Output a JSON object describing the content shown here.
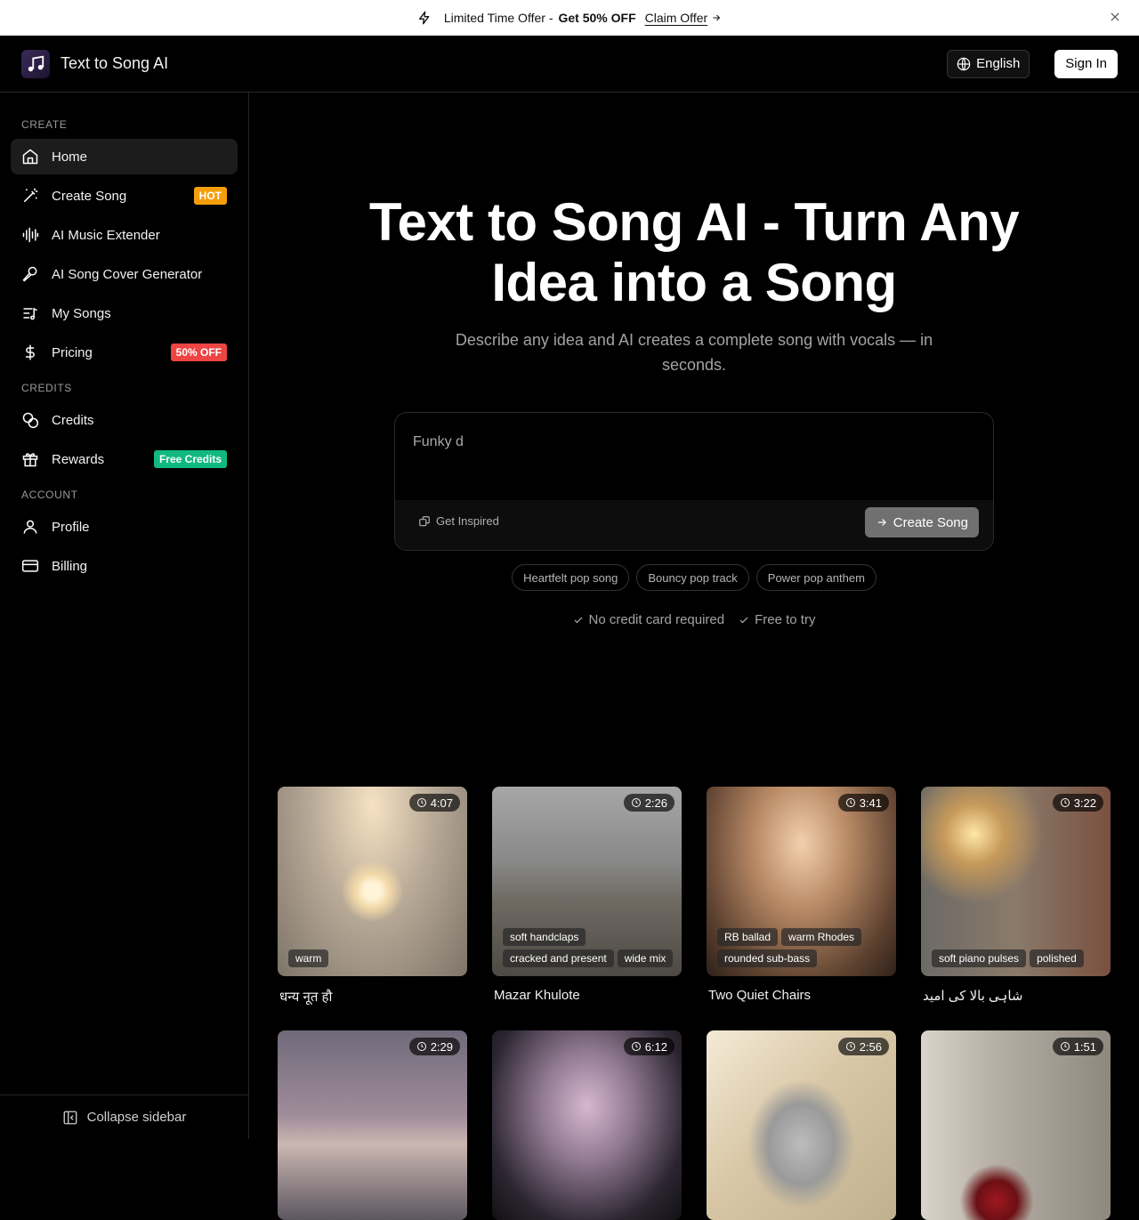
{
  "promo": {
    "text": "Limited Time Offer -",
    "highlight": "Get 50% OFF",
    "claim": "Claim Offer"
  },
  "header": {
    "brand": "Text to Song AI",
    "language": "English",
    "sign_in": "Sign In"
  },
  "sidebar": {
    "sections": {
      "create": "CREATE",
      "credits": "CREDITS",
      "account": "ACCOUNT"
    },
    "items": [
      {
        "label": "Home",
        "icon": "home-icon"
      },
      {
        "label": "Create Song",
        "icon": "wand-icon",
        "badge": "HOT"
      },
      {
        "label": "AI Music Extender",
        "icon": "waveform-icon"
      },
      {
        "label": "AI Song Cover Generator",
        "icon": "microphone-icon"
      },
      {
        "label": "My Songs",
        "icon": "music-list-icon"
      },
      {
        "label": "Pricing",
        "icon": "dollar-icon",
        "badge": "50% OFF"
      },
      {
        "label": "Credits",
        "icon": "coins-icon"
      },
      {
        "label": "Rewards",
        "icon": "gift-icon",
        "badge": "Free Credits"
      },
      {
        "label": "Profile",
        "icon": "user-icon"
      },
      {
        "label": "Billing",
        "icon": "credit-card-icon"
      }
    ],
    "collapse": "Collapse sidebar"
  },
  "hero": {
    "title_line1": "Text to Song AI - Turn Any",
    "title_line2": "Idea into a Song",
    "subtitle": "Describe any idea and AI creates a complete song with vocals — in seconds.",
    "prompt_value": "Funky d",
    "get_inspired": "Get Inspired",
    "create_button": "Create Song",
    "chips": [
      "Heartfelt pop song",
      "Bouncy pop track",
      "Power pop anthem"
    ],
    "checks": [
      "No credit card required",
      "Free to try"
    ]
  },
  "songs": [
    {
      "title": "धन्य नूत हौ",
      "duration": "4:07",
      "tags": [
        "warm"
      ]
    },
    {
      "title": "Mazar Khulote",
      "duration": "2:26",
      "tags": [
        "soft handclaps",
        "cracked and present",
        "wide mix"
      ]
    },
    {
      "title": "Two Quiet Chairs",
      "duration": "3:41",
      "tags": [
        "RB ballad",
        "warm Rhodes",
        "rounded sub-bass"
      ]
    },
    {
      "title": "شاہی بالا کی امید",
      "duration": "3:22",
      "tags": [
        "soft piano pulses",
        "polished"
      ]
    },
    {
      "title": "",
      "duration": "2:29",
      "tags": []
    },
    {
      "title": "",
      "duration": "6:12",
      "tags": []
    },
    {
      "title": "",
      "duration": "2:56",
      "tags": []
    },
    {
      "title": "",
      "duration": "1:51",
      "tags": []
    }
  ],
  "colors": {
    "hot_badge": "#f59e0b",
    "off_badge": "#ef4444",
    "free_badge": "#10b981",
    "background": "#000000"
  }
}
